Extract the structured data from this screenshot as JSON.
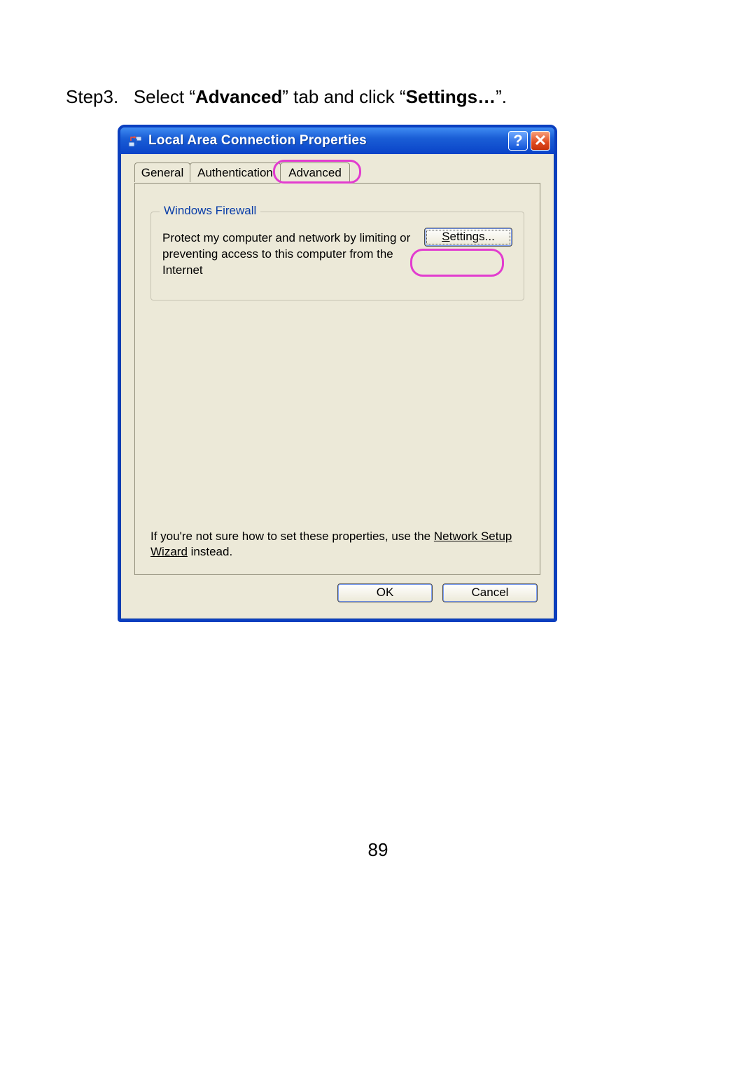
{
  "doc": {
    "step_prefix": "Step3.",
    "step_gap": "   ",
    "step_t1": "Select “",
    "step_b1": "Advanced",
    "step_t2": "” tab and click “",
    "step_b2": "Settings…",
    "step_t3": "”.",
    "page_number": "89"
  },
  "window": {
    "title": "Local Area Connection Properties",
    "help_glyph": "?",
    "close_glyph": "✕"
  },
  "tabs": {
    "general": "General",
    "authentication": "Authentication",
    "advanced": "Advanced"
  },
  "firewall": {
    "legend": "Windows Firewall",
    "description": "Protect my computer and network by limiting or preventing access to this computer from the Internet",
    "settings_first": "S",
    "settings_rest": "ettings..."
  },
  "hint": {
    "prefix": "If you're not sure how to set these properties, use the ",
    "link": "Network Setup Wizard",
    "suffix": " instead."
  },
  "buttons": {
    "ok": "OK",
    "cancel": "Cancel"
  }
}
